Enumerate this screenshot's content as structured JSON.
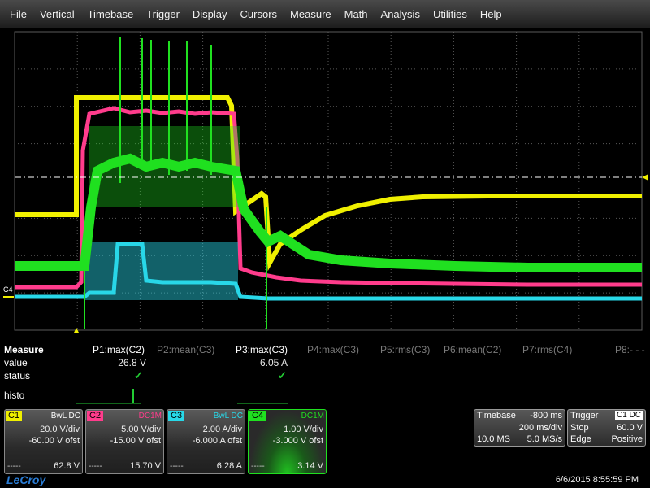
{
  "menu": [
    "File",
    "Vertical",
    "Timebase",
    "Trigger",
    "Display",
    "Cursors",
    "Measure",
    "Math",
    "Analysis",
    "Utilities",
    "Help"
  ],
  "colors": {
    "c1": "#f0f000",
    "c2": "#ff3c8c",
    "c3": "#28d8e8",
    "c4": "#20e020",
    "grid": "#5a5a5a",
    "background": "#000000"
  },
  "measure": {
    "title": "Measure",
    "rows": [
      "value",
      "status",
      "histo"
    ],
    "params": [
      {
        "label": "P1:max(C2)",
        "value": "26.8 V",
        "active": true,
        "status_ok": true
      },
      {
        "label": "P2:mean(C3)",
        "value": "",
        "active": false,
        "status_ok": false
      },
      {
        "label": "P3:max(C3)",
        "value": "6.05 A",
        "active": true,
        "status_ok": true
      },
      {
        "label": "P4:max(C3)",
        "value": "",
        "active": false,
        "status_ok": false
      },
      {
        "label": "P5:rms(C3)",
        "value": "",
        "active": false,
        "status_ok": false
      },
      {
        "label": "P6:mean(C2)",
        "value": "",
        "active": false,
        "status_ok": false
      },
      {
        "label": "P7:rms(C4)",
        "value": "",
        "active": false,
        "status_ok": false
      },
      {
        "label": "P8:- - -",
        "value": "",
        "active": false,
        "status_ok": false
      }
    ]
  },
  "channels": [
    {
      "tag": "C1",
      "flags": "BwL DC",
      "vdiv": "20.0 V/div",
      "ofst": "-60.00 V ofst",
      "dash": "-----",
      "reading": "62.8 V"
    },
    {
      "tag": "C2",
      "flags": "DC1M",
      "vdiv": "5.00 V/div",
      "ofst": "-15.00 V ofst",
      "dash": "-----",
      "reading": "15.70 V"
    },
    {
      "tag": "C3",
      "flags": "BwL DC",
      "vdiv": "2.00 A/div",
      "ofst": "-6.000 A ofst",
      "dash": "-----",
      "reading": "6.28 A"
    },
    {
      "tag": "C4",
      "flags": "DC1M",
      "vdiv": "1.00 V/div",
      "ofst": "-3.000 V ofst",
      "dash": "-----",
      "reading": "3.14 V"
    }
  ],
  "timebase": {
    "title": "Timebase",
    "delay": "-800 ms",
    "per_div": "200 ms/div",
    "samples": "10.0 MS",
    "rate": "5.0 MS/s"
  },
  "trigger": {
    "title": "Trigger",
    "source": "C1 DC",
    "mode": "Stop",
    "level": "60.0 V",
    "type": "Edge",
    "slope": "Positive"
  },
  "marker": "C4",
  "datetime": "6/6/2015 8:55:59 PM",
  "brand": "LeCroy"
}
